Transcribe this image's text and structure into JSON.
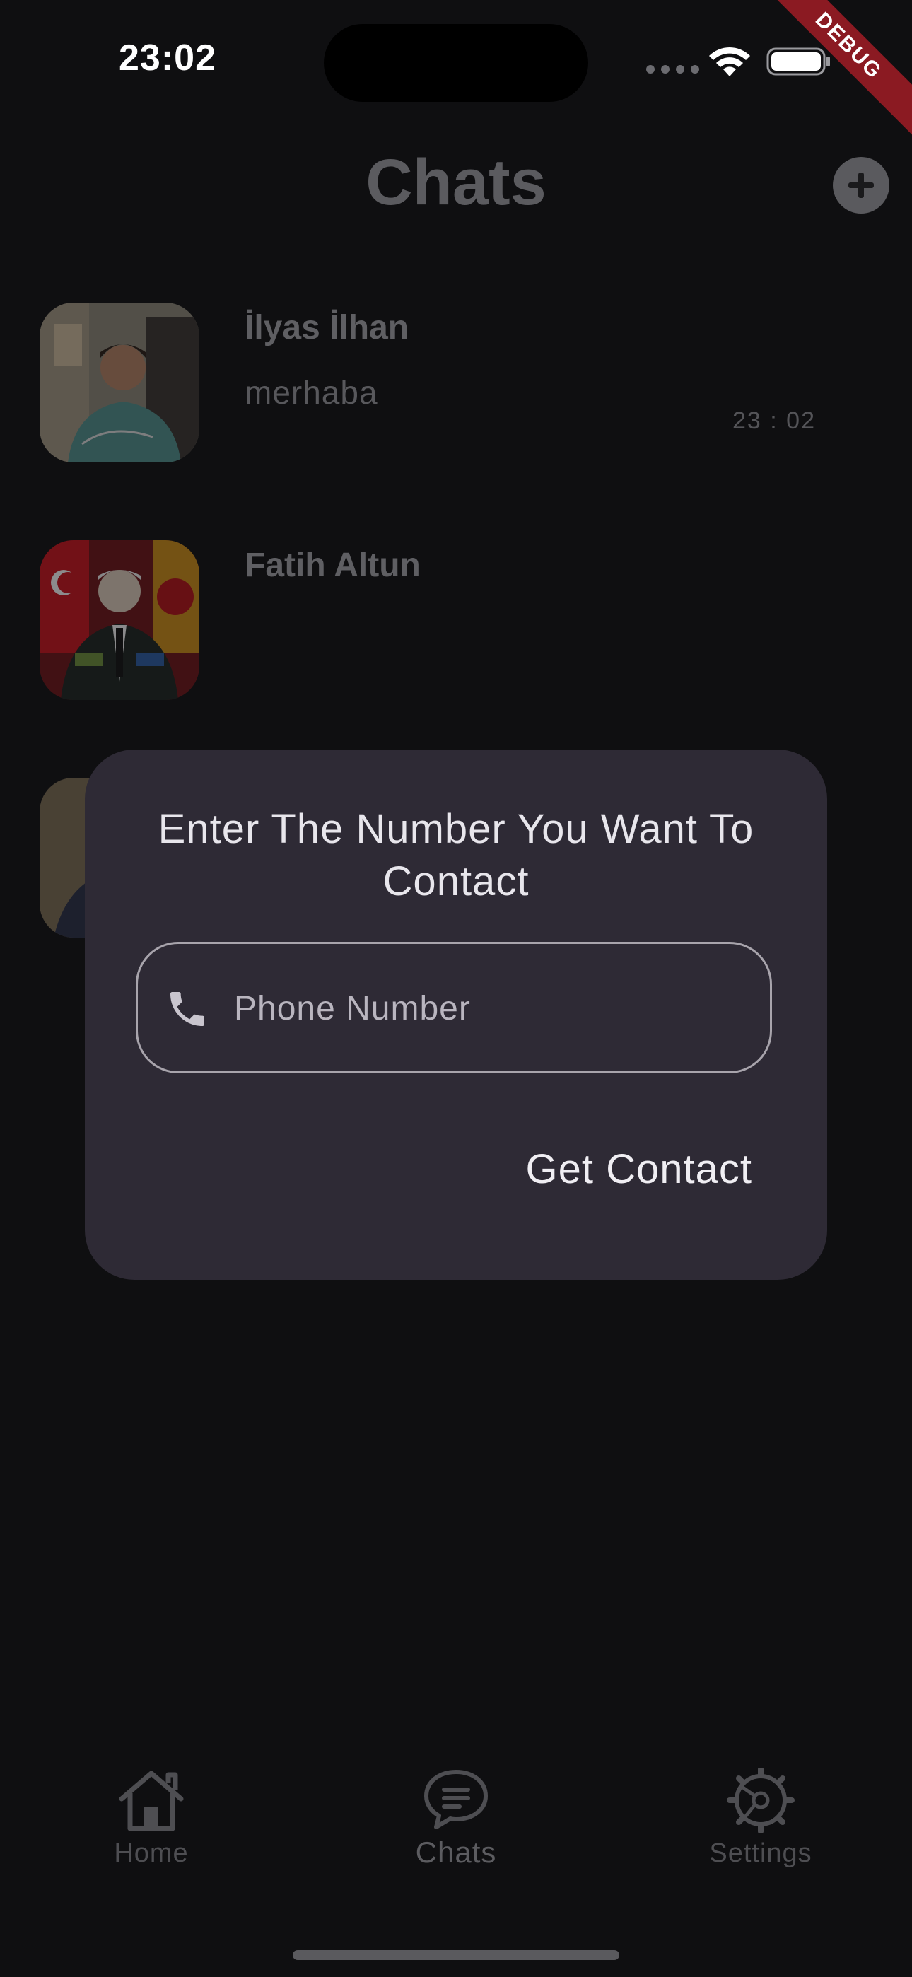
{
  "status_bar": {
    "time": "23:02",
    "debug_label": "DEBUG"
  },
  "header": {
    "title": "Chats",
    "add_icon": "plus-circle-icon"
  },
  "chats": [
    {
      "name": "İlyas İlhan",
      "message": "merhaba",
      "time": "23 : 02"
    },
    {
      "name": "Fatih Altun",
      "message": "",
      "time": ""
    }
  ],
  "dialog": {
    "title": "Enter The Number You Want To Contact",
    "phone_placeholder": "Phone Number",
    "phone_icon": "phone-icon",
    "submit_label": "Get Contact"
  },
  "bottom_nav": {
    "items": [
      {
        "label": "Home",
        "icon": "home-icon"
      },
      {
        "label": "Chats",
        "icon": "chat-bubble-icon",
        "active": true
      },
      {
        "label": "Settings",
        "icon": "gear-icon"
      }
    ]
  }
}
